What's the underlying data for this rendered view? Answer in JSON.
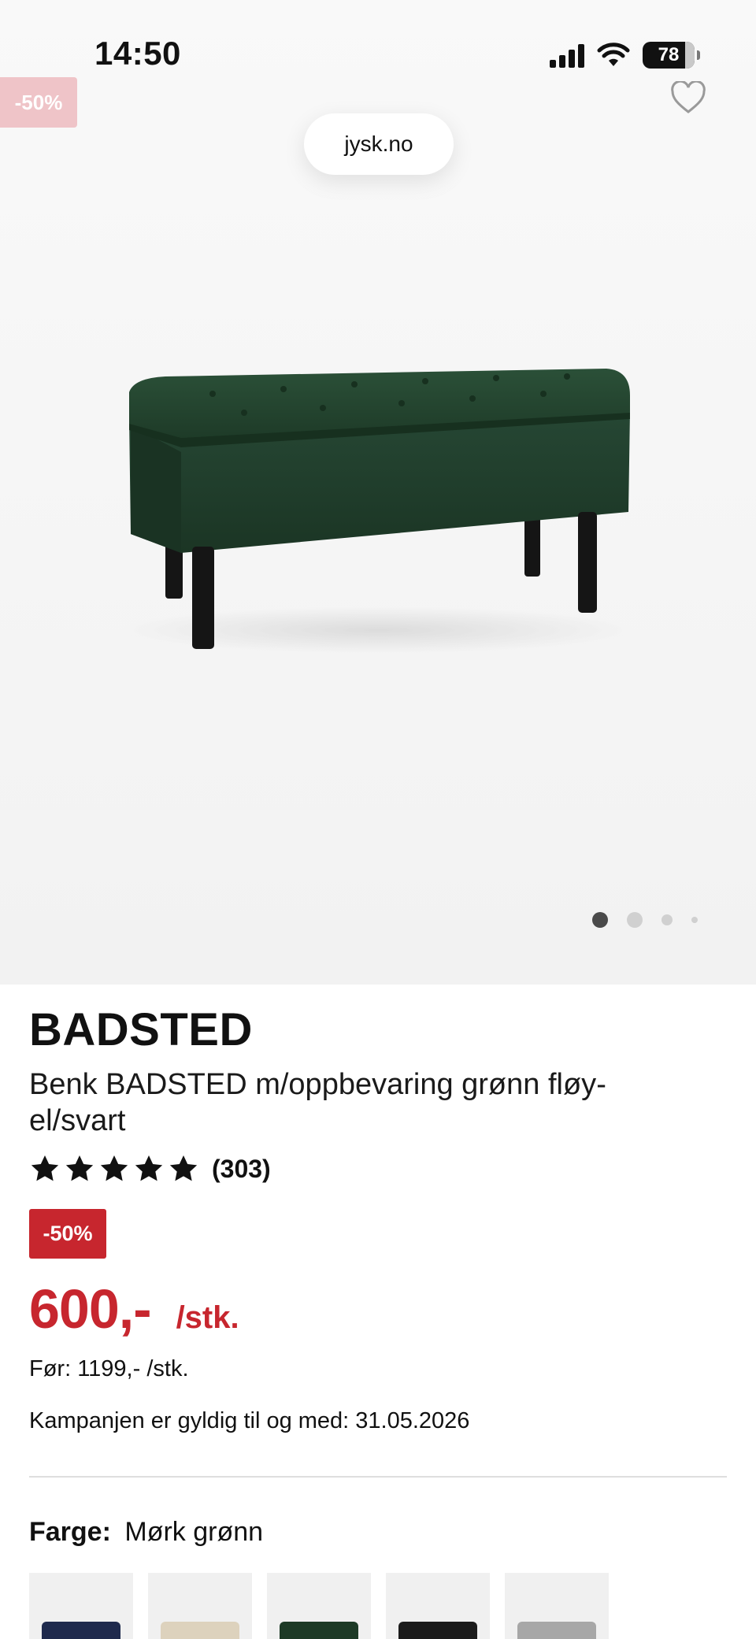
{
  "status_bar": {
    "time": "14:50",
    "battery": "78"
  },
  "browser": {
    "url": "jysk.no"
  },
  "hero": {
    "discount_label": "-50%",
    "carousel_count": 4,
    "carousel_active_index": 0
  },
  "product": {
    "brand": "BADSTED",
    "name": "Benk BADSTED m/oppbevaring grønn fløy­el/svart",
    "rating_value": 5,
    "rating_count": "(303)",
    "discount_badge": "-50%",
    "price": "600,-",
    "unit": "/stk.",
    "before_price": "Før: 1199,- /stk.",
    "campaign_text": "Kampanjen er gyldig til og med: 31.05.2026"
  },
  "color": {
    "label": "Farge:",
    "selected": "Mørk grønn",
    "swatches": [
      {
        "name": "blue",
        "color": "#1f2a4d"
      },
      {
        "name": "beige",
        "color": "#ddd2bd"
      },
      {
        "name": "green",
        "color": "#1d3a26"
      },
      {
        "name": "black",
        "color": "#1b1b1b"
      },
      {
        "name": "grey",
        "color": "#a7a7a7"
      }
    ]
  },
  "colors": {
    "accent_red": "#c7262e",
    "bench_green": "#21402c",
    "leg_black": "#151515"
  }
}
